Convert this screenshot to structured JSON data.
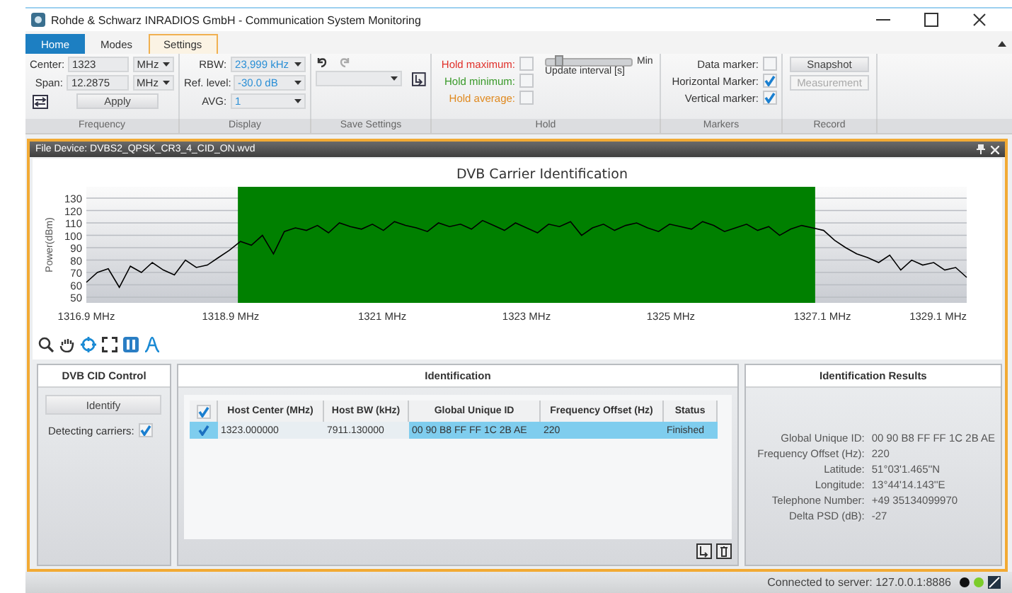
{
  "window": {
    "title": "Rohde & Schwarz INRADIOS GmbH - Communication System Monitoring"
  },
  "tabs": [
    {
      "label": "Home",
      "kind": "application",
      "selected": false
    },
    {
      "label": "Modes",
      "kind": "tab",
      "selected": false
    },
    {
      "label": "Settings",
      "kind": "tab",
      "selected": true
    }
  ],
  "ribbon": {
    "frequency": {
      "fields": [
        {
          "label": "Center:",
          "value": "1323",
          "unit": "MHz"
        },
        {
          "label": "Span:",
          "value": "12.2875",
          "unit": "MHz"
        }
      ],
      "apply": "Apply"
    },
    "display": {
      "fields": [
        {
          "label": "RBW:",
          "value": "23,999 kHz"
        },
        {
          "label": "Ref. level:",
          "value": "-30.0 dB"
        },
        {
          "label": "AVG:",
          "value": "1"
        }
      ]
    },
    "hold": {
      "items": [
        {
          "label": "Hold maximum:",
          "color": "#e0302a",
          "checked": false
        },
        {
          "label": "Hold minimum:",
          "color": "#3a9a2a",
          "checked": false
        },
        {
          "label": "Hold average:",
          "color": "#e08a20",
          "checked": false
        }
      ],
      "slider": {
        "label": "Update interval [s]",
        "end_label": "Min",
        "level": 0.15
      }
    },
    "markers": [
      {
        "label": "Data marker:",
        "checked": false
      },
      {
        "label": "Horizontal Marker:",
        "checked": true
      },
      {
        "label": "Vertical marker:",
        "checked": true
      }
    ],
    "record": [
      {
        "label": "Snapshot",
        "disabled": false
      },
      {
        "label": "Measurement",
        "disabled": true
      }
    ],
    "group_labels": [
      "Frequency",
      "Display",
      "Save Settings",
      "Hold",
      "Markers",
      "Record"
    ]
  },
  "panel": {
    "title": "File Device: DVBS2_QPSK_CR3_4_CID_ON.wvd"
  },
  "chart": {
    "chart_data": {
      "type": "line",
      "title": "DVB Carrier Identification",
      "ylabel": "Power(dBm)",
      "grid": true,
      "xlim": [
        1316.9,
        1329.1
      ],
      "ylim": [
        50,
        130
      ],
      "x": [
        1316.9,
        1317.0525,
        1317.205,
        1317.3575,
        1317.51,
        1317.6625,
        1317.815,
        1317.9675,
        1318.12,
        1318.2725,
        1318.425,
        1318.5775,
        1318.73,
        1318.8825,
        1319.035,
        1319.1875,
        1319.34,
        1319.4925,
        1319.645,
        1319.7975,
        1319.95,
        1320.1025,
        1320.255,
        1320.4075,
        1320.56,
        1320.7125,
        1320.865,
        1321.0175,
        1321.17,
        1321.3225,
        1321.475,
        1321.6275,
        1321.78,
        1321.9325,
        1322.085,
        1322.2375,
        1322.39,
        1322.5425,
        1322.695,
        1322.8475,
        1323.0,
        1323.1525,
        1323.305,
        1323.4575,
        1323.61,
        1323.7625,
        1323.915,
        1324.0675,
        1324.22,
        1324.3725,
        1324.525,
        1324.6775,
        1324.83,
        1324.9825,
        1325.135,
        1325.2875,
        1325.44,
        1325.5925,
        1325.745,
        1325.8975,
        1326.05,
        1326.2025,
        1326.355,
        1326.5075,
        1326.66,
        1326.8125,
        1326.965,
        1327.1175,
        1327.27,
        1327.4225,
        1327.575,
        1327.7275,
        1327.88,
        1328.0325,
        1328.185,
        1328.3375,
        1328.49,
        1328.6425,
        1328.795,
        1328.9475,
        1329.1
      ],
      "yticks": [
        130,
        120,
        110,
        100,
        90,
        80,
        70,
        60,
        50
      ],
      "xticks": [
        {
          "value": 1316.9,
          "label": "1316.9 MHz"
        },
        {
          "value": 1318.9,
          "label": "1318.9 MHz"
        },
        {
          "value": 1321,
          "label": "1321 MHz"
        },
        {
          "value": 1323,
          "label": "1323 MHz"
        },
        {
          "value": 1325,
          "label": "1325 MHz"
        },
        {
          "value": 1327.1,
          "label": "1327.1 MHz"
        },
        {
          "value": 1329.1,
          "label": "1329.1 MHz"
        }
      ],
      "series": [
        {
          "color": "#000000",
          "values": [
            62,
            70,
            73,
            58,
            75,
            70,
            78,
            72,
            68,
            80,
            74,
            76,
            82,
            88,
            95,
            92,
            100,
            85,
            103,
            106,
            104,
            108,
            102,
            110,
            107,
            105,
            109,
            104,
            111,
            108,
            106,
            103,
            110,
            107,
            109,
            105,
            112,
            108,
            104,
            110,
            106,
            102,
            109,
            107,
            111,
            100,
            106,
            109,
            104,
            108,
            110,
            106,
            103,
            109,
            107,
            105,
            111,
            108,
            103,
            106,
            109,
            104,
            107,
            100,
            105,
            108,
            106,
            104,
            96,
            90,
            85,
            82,
            78,
            84,
            72,
            80,
            76,
            78,
            72,
            74,
            66
          ]
        }
      ],
      "bands": [
        {
          "axis": "x",
          "from": 1319.0,
          "to": 1327.0,
          "color": "#008000"
        }
      ]
    }
  },
  "cid_control": {
    "title": "DVB CID Control",
    "button": "Identify",
    "detecting": {
      "label": "Detecting carriers:",
      "checked": true
    }
  },
  "identification": {
    "title": "Identification",
    "header_checked": true,
    "columns": [
      "Host Center (MHz)",
      "Host BW (kHz)",
      "Global Unique ID",
      "Frequency Offset (Hz)",
      "Status"
    ],
    "rows": [
      {
        "checked": true,
        "selected": true,
        "cells": [
          "1323.000000",
          "7911.130000",
          "00 90 B8 FF FF 1C 2B AE",
          "220",
          "Finished"
        ]
      }
    ]
  },
  "results": {
    "title": "Identification Results",
    "fields": [
      {
        "label": "Global Unique ID:",
        "value": "00 90 B8 FF FF 1C 2B AE"
      },
      {
        "label": "Frequency Offset (Hz):",
        "value": "220"
      },
      {
        "label": "Latitude:",
        "value": "51°03'1.465''N"
      },
      {
        "label": "Longitude:",
        "value": "13°44'14.143''E"
      },
      {
        "label": "Telephone Number:",
        "value": "+49 35134099970"
      },
      {
        "label": "Delta PSD (dB):",
        "value": "-27"
      }
    ]
  },
  "status_bar": {
    "text": "Connected to server: 127.0.0.1:8886"
  }
}
